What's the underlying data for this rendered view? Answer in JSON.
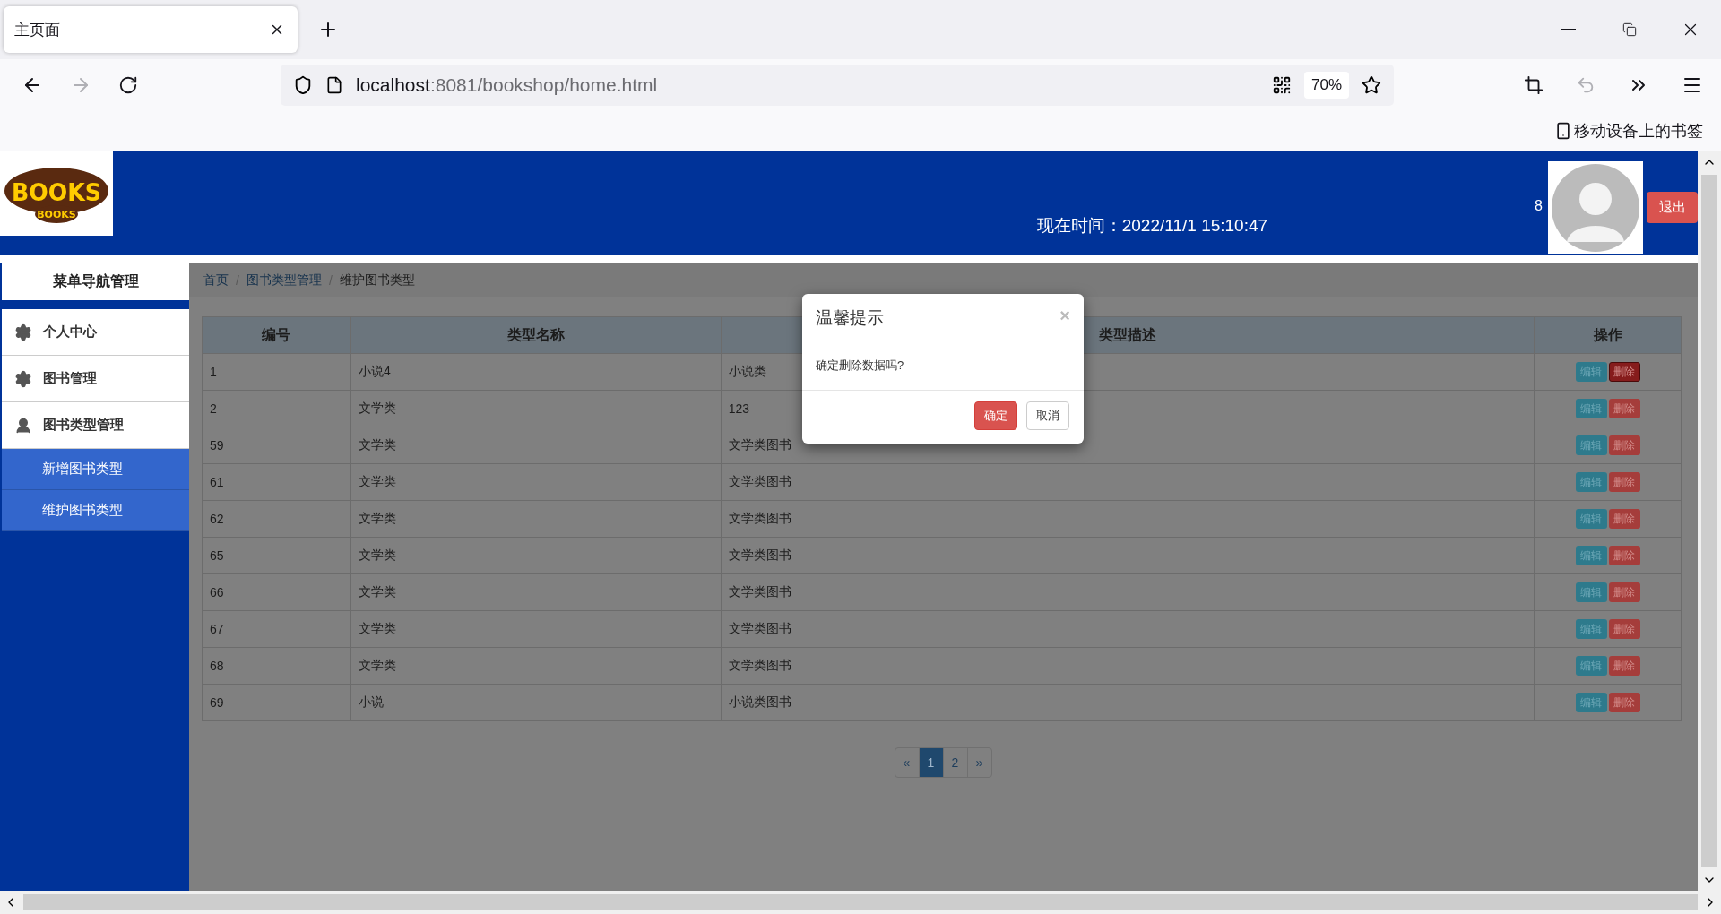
{
  "browser": {
    "tabs": [
      {
        "title": "主页面",
        "selected": true
      }
    ],
    "nav": {
      "back_disabled": false,
      "forward_disabled": true
    },
    "url": {
      "host": "localhost",
      "path": ":8081/bookshop/home.html"
    },
    "zoom": "70%",
    "bookmarks": {
      "label": "移动设备上的书签"
    }
  },
  "header": {
    "logo": {
      "title": "BOOKS",
      "subtitle": "BOOKS"
    },
    "clock": {
      "label": "现在时间：",
      "value": "2022/11/1 15:10:47"
    },
    "user_count": "8",
    "logout": "退出"
  },
  "sidebar": {
    "title": "菜单导航管理",
    "items": [
      {
        "label": "个人中心",
        "kind": "gear"
      },
      {
        "label": "图书管理",
        "kind": "gear"
      },
      {
        "label": "图书类型管理",
        "kind": "user",
        "children": [
          {
            "label": "新增图书类型"
          },
          {
            "label": "维护图书类型"
          }
        ]
      }
    ]
  },
  "breadcrumb": [
    {
      "label": "首页",
      "link": true
    },
    {
      "separator": "/",
      "label": "图书类型管理",
      "link": true
    },
    {
      "separator": "/",
      "label": "维护图书类型",
      "link": false
    }
  ],
  "table": {
    "columns": [
      "编号",
      "类型名称",
      "类型描述",
      "操作"
    ],
    "rows": [
      {
        "id": "1",
        "name": "小说4",
        "description": "小说类",
        "actions": [
          {
            "label": "编辑",
            "kind": "edit",
            "focused": false
          },
          {
            "label": "删除",
            "kind": "delete",
            "focused": true
          }
        ]
      },
      {
        "id": "2",
        "name": "文学类",
        "description": "123",
        "actions": [
          {
            "label": "编辑",
            "kind": "edit",
            "focused": false
          },
          {
            "label": "删除",
            "kind": "delete",
            "focused": false
          }
        ]
      },
      {
        "id": "59",
        "name": "文学类",
        "description": "文学类图书",
        "actions": [
          {
            "label": "编辑",
            "kind": "edit",
            "focused": false
          },
          {
            "label": "删除",
            "kind": "delete",
            "focused": false
          }
        ]
      },
      {
        "id": "61",
        "name": "文学类",
        "description": "文学类图书",
        "actions": [
          {
            "label": "编辑",
            "kind": "edit",
            "focused": false
          },
          {
            "label": "删除",
            "kind": "delete",
            "focused": false
          }
        ]
      },
      {
        "id": "62",
        "name": "文学类",
        "description": "文学类图书",
        "actions": [
          {
            "label": "编辑",
            "kind": "edit",
            "focused": false
          },
          {
            "label": "删除",
            "kind": "delete",
            "focused": false
          }
        ]
      },
      {
        "id": "65",
        "name": "文学类",
        "description": "文学类图书",
        "actions": [
          {
            "label": "编辑",
            "kind": "edit",
            "focused": false
          },
          {
            "label": "删除",
            "kind": "delete",
            "focused": false
          }
        ]
      },
      {
        "id": "66",
        "name": "文学类",
        "description": "文学类图书",
        "actions": [
          {
            "label": "编辑",
            "kind": "edit",
            "focused": false
          },
          {
            "label": "删除",
            "kind": "delete",
            "focused": false
          }
        ]
      },
      {
        "id": "67",
        "name": "文学类",
        "description": "文学类图书",
        "actions": [
          {
            "label": "编辑",
            "kind": "edit",
            "focused": false
          },
          {
            "label": "删除",
            "kind": "delete",
            "focused": false
          }
        ]
      },
      {
        "id": "68",
        "name": "文学类",
        "description": "文学类图书",
        "actions": [
          {
            "label": "编辑",
            "kind": "edit",
            "focused": false
          },
          {
            "label": "删除",
            "kind": "delete",
            "focused": false
          }
        ]
      },
      {
        "id": "69",
        "name": "小说",
        "description": "小说类图书",
        "actions": [
          {
            "label": "编辑",
            "kind": "edit",
            "focused": false
          },
          {
            "label": "删除",
            "kind": "delete",
            "focused": false
          }
        ]
      }
    ]
  },
  "pagination": {
    "prev": "«",
    "pages": [
      {
        "label": "1",
        "selected": true
      },
      {
        "label": "2",
        "selected": false
      }
    ],
    "next": "»"
  },
  "dialog": {
    "title": "温馨提示",
    "close": "×",
    "message": "确定删除数据吗?",
    "buttons": [
      {
        "label": "确定",
        "kind": "primary"
      },
      {
        "label": "取消",
        "kind": "default"
      }
    ]
  }
}
